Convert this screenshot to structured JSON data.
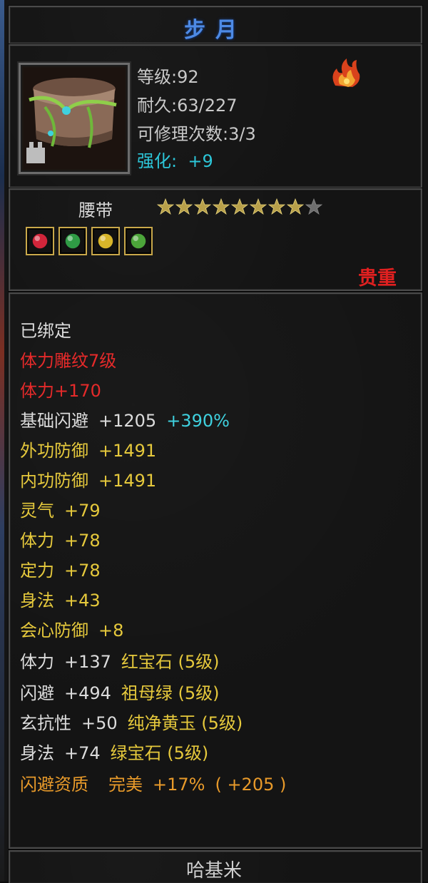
{
  "item": {
    "name": "步月",
    "level_label": "等级",
    "level": "92",
    "durability_label": "耐久",
    "durability": "63/227",
    "repair_label": "可修理次数",
    "repair": "3/3",
    "enhance_label": "强化:",
    "enhance": "+9",
    "type": "腰带",
    "stars_filled": 8,
    "stars_total": 9,
    "quality": "贵重",
    "owner": "哈基米"
  },
  "gems": [
    {
      "name": "ruby-gem",
      "color": "#d1253a"
    },
    {
      "name": "emerald-gem",
      "color": "#2f9b45"
    },
    {
      "name": "yellow-jade-gem",
      "color": "#d8b52a"
    },
    {
      "name": "green-gem",
      "color": "#4ca53a"
    }
  ],
  "attributes": {
    "bound": "已绑定",
    "carving": "体力雕纹7级",
    "carving_bonus": "体力+170",
    "dodge_label": "基础闪避",
    "dodge_value": "+1205",
    "dodge_pct": "+390%",
    "ext_def_label": "外功防御",
    "ext_def_value": "+1491",
    "int_def_label": "内功防御",
    "int_def_value": "+1491",
    "spirit_label": "灵气",
    "spirit_value": "+79",
    "stamina_label": "体力",
    "stamina_value": "+78",
    "focus_label": "定力",
    "focus_value": "+78",
    "agility_label": "身法",
    "agility_value": "+43",
    "crit_def_label": "会心防御",
    "crit_def_value": "+8",
    "gem1_stat": "体力",
    "gem1_value": "+137",
    "gem1_name": "红宝石 (5级)",
    "gem2_stat": "闪避",
    "gem2_value": "+494",
    "gem2_name": "祖母绿 (5级)",
    "gem3_stat": "玄抗性",
    "gem3_value": "+50",
    "gem3_name": "纯净黄玉 (5级)",
    "gem4_stat": "身法",
    "gem4_value": "+74",
    "gem4_name": "绿宝石 (5级)",
    "aptitude_label": "闪避资质",
    "aptitude_grade": "完美",
    "aptitude_pct": "+17%",
    "aptitude_bonus": "( +205 )"
  },
  "colors": {
    "title": "#4d8ae5",
    "quality": "#e02020",
    "enhance": "#2cc6d8",
    "attr_yellow": "#e6c93c",
    "attr_red": "#e52a2a",
    "attr_cyan": "#3fd1df",
    "attr_orange": "#e89a2a"
  }
}
